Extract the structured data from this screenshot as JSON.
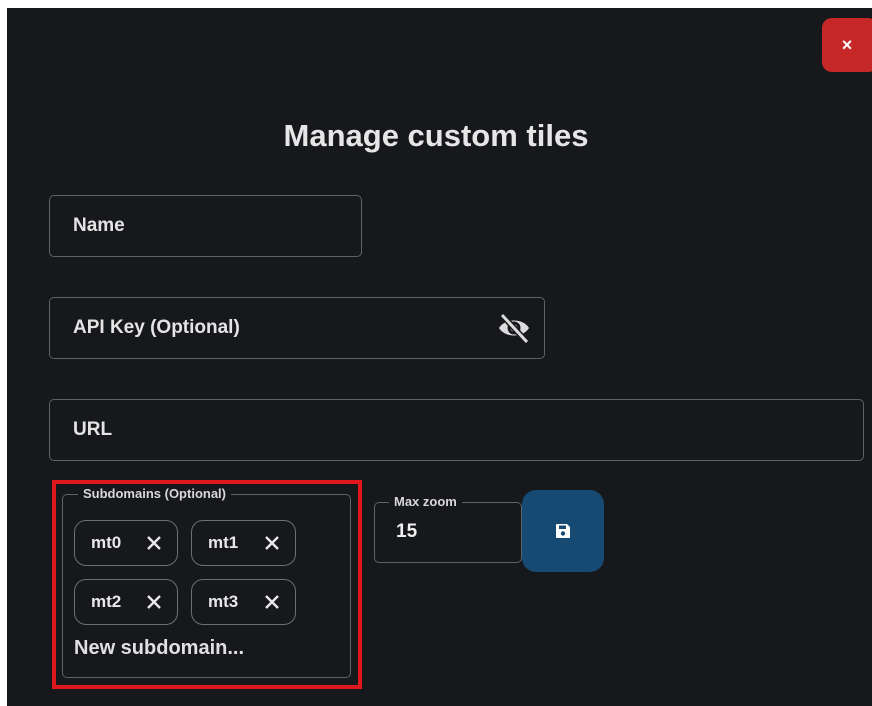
{
  "dialog": {
    "title": "Manage custom tiles",
    "close_label": "×"
  },
  "fields": {
    "name_label": "Name",
    "api_key_label": "API Key (Optional)",
    "url_label": "URL"
  },
  "subdomains": {
    "legend": "Subdomains (Optional)",
    "chips": [
      "mt0",
      "mt1",
      "mt2",
      "mt3"
    ],
    "new_placeholder": "New subdomain..."
  },
  "max_zoom": {
    "legend": "Max zoom",
    "value": "15"
  },
  "icons": {
    "close": "close-icon",
    "visibility": "eye-off-icon",
    "chip_remove": "close-icon",
    "save": "save-icon"
  },
  "colors": {
    "background": "#16181c",
    "close_button": "#c62828",
    "save_button": "#174a73",
    "highlight": "#e0171d"
  }
}
